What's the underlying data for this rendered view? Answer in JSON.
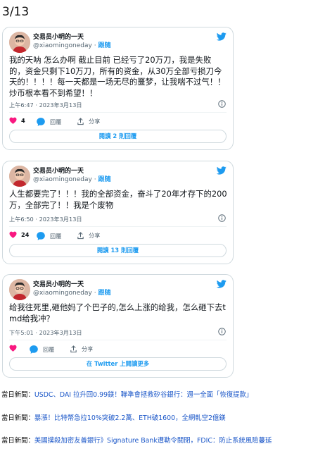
{
  "page_counter": "3/13",
  "accent_color": "#1d9bf0",
  "like_color": "#f91880",
  "tweets": [
    {
      "author_name": "交易员小明的一天",
      "handle": "@xiaomingoneday",
      "separator": "·",
      "follow_label": "跟随",
      "text": "我的天呐 怎么办啊 截止目前 已经亏了20万刀，我是失败的，资金只剩下10万刀，所有的资金，从30万全部亏损刀今天的！！！！每一天都是一场无尽的噩梦，让我喘不过气！！炒币根本看不到希望！！",
      "timestamp": "上午6:47 · 2023年3月13日",
      "likes": "4",
      "reply_label": "回覆",
      "share_label": "分享",
      "replies_button": "閱讀 2 則回覆"
    },
    {
      "author_name": "交易员小明的一天",
      "handle": "@xiaomingoneday",
      "separator": "·",
      "follow_label": "跟随",
      "text": "人生都要完了！！！我的全部资金，奋斗了20年才存下的200万，全部完了！！我是个废物",
      "timestamp": "上午6:50 · 2023年3月13日",
      "likes": "24",
      "reply_label": "回覆",
      "share_label": "分享",
      "replies_button": "閱讀 13 則回覆"
    },
    {
      "author_name": "交易员小明的一天",
      "handle": "@xiaomingoneday",
      "separator": "·",
      "follow_label": "跟随",
      "text": "给我往死里,砸他妈了个巴子的,怎么上涨的给我，怎么砸下去tmd给我冲？",
      "timestamp": "下午5:01 · 2023年3月13日",
      "likes": "",
      "reply_label": "回覆",
      "share_label": "分享",
      "replies_button": "在 Twitter 上閱讀更多"
    }
  ],
  "news": [
    {
      "prefix": "當日新聞：",
      "link": "USDC、DAI 拉升回0.99鎂！聯準會拯救矽谷銀行：週一全面「恢復提款」"
    },
    {
      "prefix": "當日新聞：",
      "link": "暴漲！比特幣急拉10%突破2.2萬、ETH破1600，全網軋空2億鎂"
    },
    {
      "prefix": "當日新聞：",
      "link": "美國撲殺加密友善銀行》Signature Bank遭勒令關閉，FDIC：防止系統風險蔓延"
    }
  ]
}
